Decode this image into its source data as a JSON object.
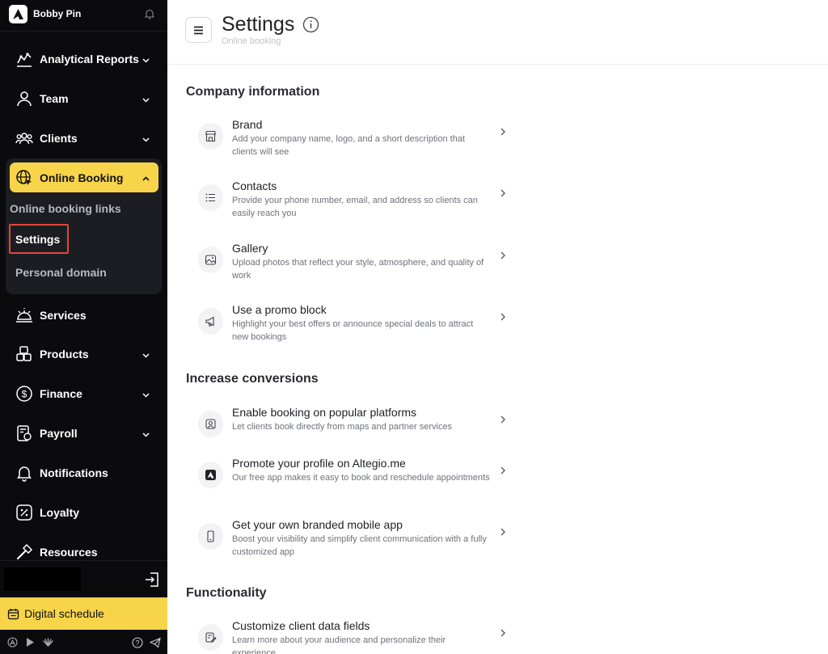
{
  "sidebar": {
    "user_name": "Bobby Pin",
    "nav": {
      "analytics": "Analytical Reports",
      "team": "Team",
      "clients": "Clients",
      "online_booking": "Online Booking",
      "services": "Services",
      "products": "Products",
      "finance": "Finance",
      "payroll": "Payroll",
      "notifications": "Notifications",
      "loyalty": "Loyalty",
      "resources": "Resources"
    },
    "submenu": {
      "links": "Online booking links",
      "settings": "Settings",
      "domain": "Personal domain"
    },
    "digital_schedule": "Digital schedule"
  },
  "header": {
    "title": "Settings",
    "breadcrumb": "Online booking"
  },
  "sections": {
    "company": {
      "title": "Company information",
      "brand": {
        "title": "Brand",
        "desc": "Add your company name, logo, and a short description that clients will see"
      },
      "contacts": {
        "title": "Contacts",
        "desc": "Provide your phone number, email, and address so clients can easily reach you"
      },
      "gallery": {
        "title": "Gallery",
        "desc": "Upload photos that reflect your style, atmosphere, and quality of work"
      },
      "promo": {
        "title": "Use a promo block",
        "desc": "Highlight your best offers or announce special deals to attract new bookings"
      }
    },
    "conversions": {
      "title": "Increase conversions",
      "platforms": {
        "title": "Enable booking on popular platforms",
        "desc": "Let clients book directly from maps and partner services"
      },
      "altegio": {
        "title": "Promote your profile on Altegio.me",
        "desc": "Our free app makes it easy to book and reschedule appointments"
      },
      "mobile": {
        "title": "Get your own branded mobile app",
        "desc": "Boost your visibility and simplify client communication with a fully customized app"
      }
    },
    "functionality": {
      "title": "Functionality",
      "fields": {
        "title": "Customize client data fields",
        "desc": "Learn more about your audience and personalize their experience"
      }
    }
  },
  "colors": {
    "sidebar_bg": "#0b0b0d",
    "accent_yellow": "#f7d44a",
    "highlight_red": "#e0483a"
  },
  "icons": {
    "analytics": "chart-line-icon",
    "team": "user-icon",
    "clients": "users-icon",
    "online_booking": "globe-cursor-icon",
    "services": "bell-service-icon",
    "products": "boxes-icon",
    "finance": "dollar-circle-icon",
    "payroll": "payroll-icon",
    "notifications": "bell-icon",
    "loyalty": "percent-badge-icon",
    "resources": "hammer-icon"
  }
}
